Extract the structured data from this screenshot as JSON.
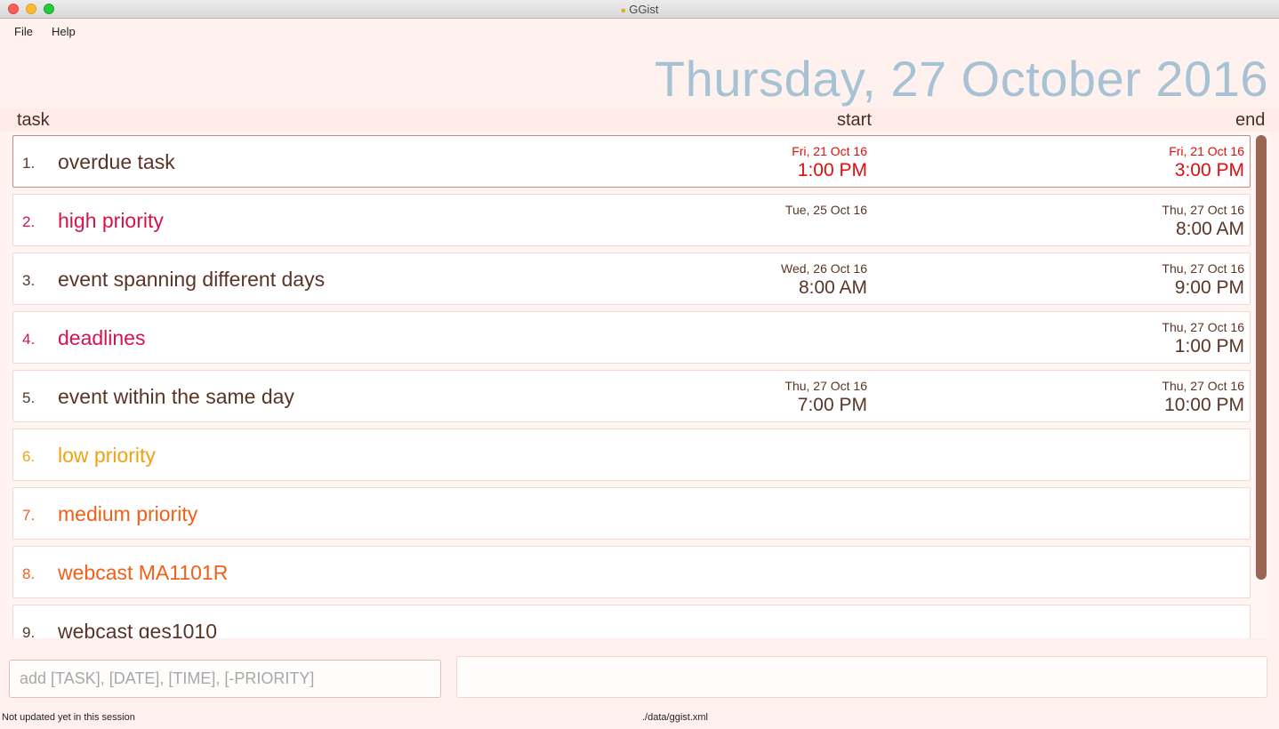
{
  "window": {
    "title": "GGist"
  },
  "menu": {
    "file": "File",
    "help": "Help"
  },
  "date_heading": "Thursday, 27 October 2016",
  "columns": {
    "task": "task",
    "start": "start",
    "end": "end"
  },
  "tasks": [
    {
      "index": "1.",
      "name": "overdue task",
      "start_date": "Fri, 21 Oct 16",
      "start_time": "1:00 PM",
      "end_date": "Fri, 21 Oct 16",
      "end_time": "3:00 PM"
    },
    {
      "index": "2.",
      "name": "high priority",
      "start_date": "Tue, 25 Oct 16",
      "start_time": "",
      "end_date": "Thu, 27 Oct 16",
      "end_time": "8:00 AM"
    },
    {
      "index": "3.",
      "name": "event spanning different days",
      "start_date": "Wed, 26 Oct 16",
      "start_time": "8:00 AM",
      "end_date": "Thu, 27 Oct 16",
      "end_time": "9:00 PM"
    },
    {
      "index": "4.",
      "name": "deadlines",
      "start_date": "",
      "start_time": "",
      "end_date": "Thu, 27 Oct 16",
      "end_time": "1:00 PM"
    },
    {
      "index": "5.",
      "name": "event within the same day",
      "start_date": "Thu, 27 Oct 16",
      "start_time": "7:00 PM",
      "end_date": "Thu, 27 Oct 16",
      "end_time": "10:00 PM"
    },
    {
      "index": "6.",
      "name": "low priority",
      "start_date": "",
      "start_time": "",
      "end_date": "",
      "end_time": ""
    },
    {
      "index": "7.",
      "name": "medium priority",
      "start_date": "",
      "start_time": "",
      "end_date": "",
      "end_time": ""
    },
    {
      "index": "8.",
      "name": "webcast MA1101R",
      "start_date": "",
      "start_time": "",
      "end_date": "",
      "end_time": ""
    },
    {
      "index": "9.",
      "name": "webcast ges1010",
      "start_date": "",
      "start_time": "",
      "end_date": "",
      "end_time": ""
    }
  ],
  "command": {
    "placeholder": "add [TASK], [DATE], [TIME], [-PRIORITY]",
    "value": ""
  },
  "result": "",
  "status": {
    "sync": "Not updated yet in this session",
    "file": "./data/ggist.xml"
  },
  "colors": {
    "normal": "#5a3527",
    "high": "#d4144f",
    "low": "#f2a20f",
    "medium": "#f06018",
    "overdue": "#e00d0d",
    "date_heading": "#a6c2d4"
  }
}
